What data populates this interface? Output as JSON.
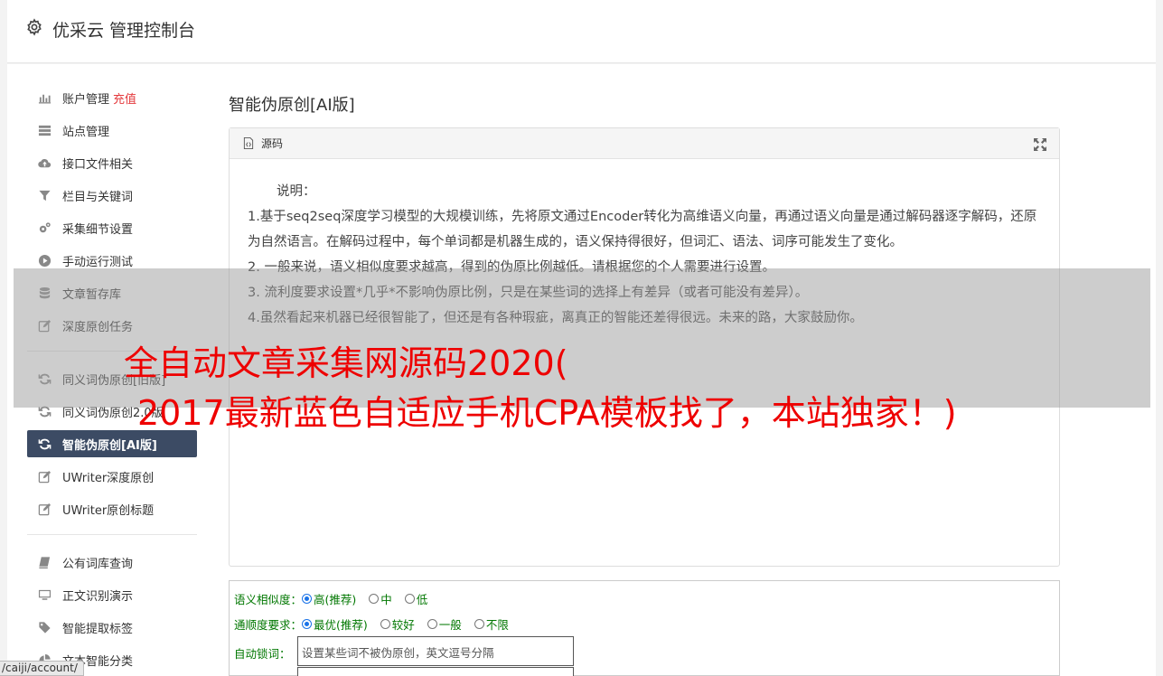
{
  "header": {
    "title": "优采云 管理控制台"
  },
  "sidebar": {
    "group1": [
      {
        "label": "账户管理",
        "badge": "充值",
        "icon": "bar-chart-icon"
      },
      {
        "label": "站点管理",
        "icon": "list-icon"
      },
      {
        "label": "接口文件相关",
        "icon": "cloud-upload-icon"
      },
      {
        "label": "栏目与关键词",
        "icon": "filter-icon"
      },
      {
        "label": "采集细节设置",
        "icon": "gears-icon"
      },
      {
        "label": "手动运行测试",
        "icon": "play-circle-icon"
      },
      {
        "label": "文章暂存库",
        "icon": "database-icon"
      },
      {
        "label": "深度原创任务",
        "icon": "edit-icon"
      }
    ],
    "group2": [
      {
        "label": "同义词伪原创[旧版]",
        "icon": "refresh-icon"
      },
      {
        "label": "同义词伪原创2.0版",
        "icon": "refresh-icon"
      },
      {
        "label": "智能伪原创[AI版]",
        "icon": "refresh-icon",
        "active": true
      },
      {
        "label": "UWriter深度原创",
        "icon": "edit-icon"
      },
      {
        "label": "UWriter原创标题",
        "icon": "edit-icon"
      }
    ],
    "group3": [
      {
        "label": "公有词库查询",
        "icon": "book-icon"
      },
      {
        "label": "正文识别演示",
        "icon": "monitor-icon"
      },
      {
        "label": "智能提取标签",
        "icon": "tag-icon"
      },
      {
        "label": "文本智能分类",
        "icon": "pie-chart-icon"
      }
    ]
  },
  "main": {
    "title": "智能伪原创[AI版]",
    "box": {
      "head": "源码",
      "lines": [
        "说明：",
        "1.基于seq2seq深度学习模型的大规模训练，先将原文通过Encoder转化为高维语义向量，再通过语义向量是通过解码器逐字解码，还原为自然语言。在解码过程中，每个单词都是机器生成的，语义保持得很好，但词汇、语法、词序可能发生了变化。",
        "2. 一般来说，语义相似度要求越高，得到的伪原比例越低。请根据您的个人需要进行设置。",
        "3. 流利度要求设置*几乎*不影响伪原比例，只是在某些词的选择上有差异（或者可能没有差异）。",
        "4.虽然看起来机器已经很智能了，但还是有各种瑕疵，离真正的智能还差得很远。未来的路，大家鼓励你。"
      ]
    },
    "form": {
      "similarity": {
        "label": "语义相似度：",
        "options": [
          "高(推荐)",
          "中",
          "低"
        ],
        "selected": "高(推荐)"
      },
      "fluency": {
        "label": "通顺度要求：",
        "options": [
          "最优(推荐)",
          "较好",
          "一般",
          "不限"
        ],
        "selected": "最优(推荐)"
      },
      "lock": {
        "label": "自动锁词：",
        "placeholder": "设置某些词不被伪原创，英文逗号分隔"
      }
    }
  },
  "overlay": {
    "line1": "全自动文章采集网源码2020(",
    "line2": "2017最新蓝色自适应手机CPA模板找了，本站独家！)"
  },
  "status": "/caiji/account/"
}
